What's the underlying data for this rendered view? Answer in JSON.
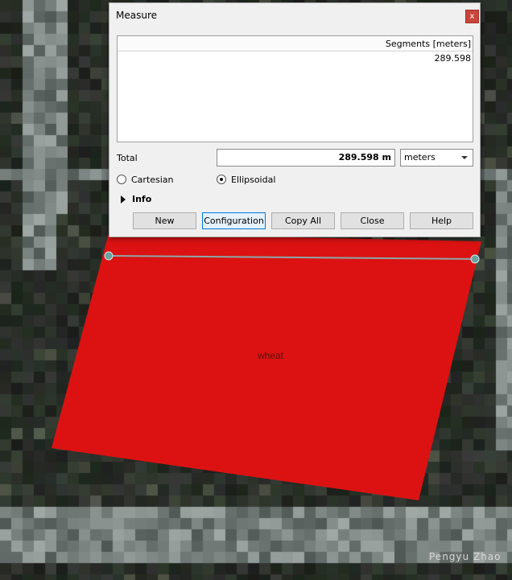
{
  "dialog": {
    "title": "Measure",
    "close_label": "x",
    "segments_header": "Segments [meters]",
    "segments": [
      "289.598"
    ],
    "total_label": "Total",
    "total_value": "289.598 m",
    "unit": "meters",
    "mode_options": [
      {
        "label": "Cartesian",
        "selected": false
      },
      {
        "label": "Ellipsoidal",
        "selected": true
      }
    ],
    "info_label": "Info",
    "buttons": {
      "new": "New",
      "configuration": "Configuration",
      "copy_all": "Copy All",
      "close": "Close",
      "help": "Help"
    }
  },
  "map": {
    "feature_label": "wheat",
    "feature_color": "#dc1212",
    "measure_line_color": "#8aa8a8",
    "watermark": "Pengyu Zhao"
  }
}
